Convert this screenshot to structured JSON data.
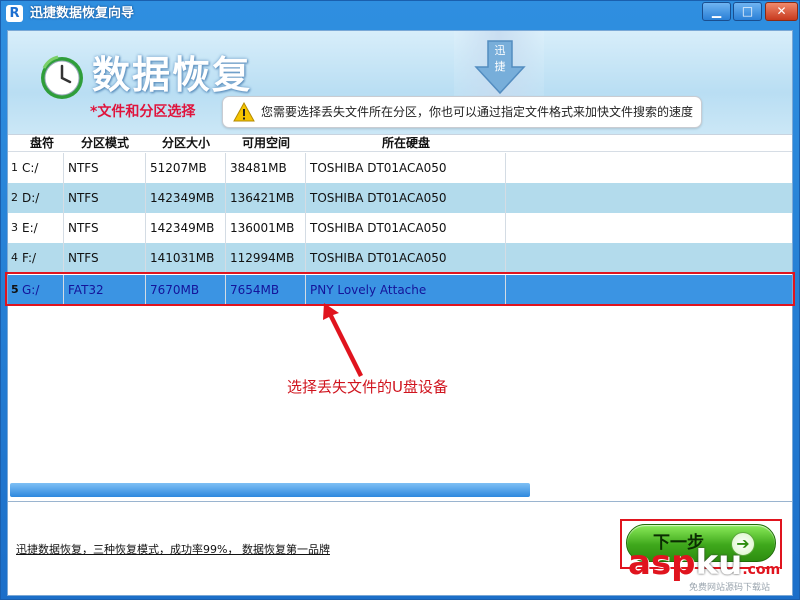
{
  "window": {
    "icon_letter": "R",
    "title": "迅捷数据恢复向导",
    "min_glyph": "▁",
    "max_glyph": "□",
    "close_glyph": "✕"
  },
  "banner": {
    "title": "数据恢复",
    "watermark_text": "迅捷",
    "step_label": "*文件和分区选择",
    "hint": "您需要选择丢失文件所在分区，你也可以通过指定文件格式来加快文件搜索的速度"
  },
  "table": {
    "headers": [
      "盘符",
      "分区模式",
      "分区大小",
      "可用空间",
      "所在硬盘"
    ],
    "rows": [
      {
        "num": "1",
        "drive": "C:/",
        "fs": "NTFS",
        "size": "51207MB",
        "free": "38481MB",
        "disk": "TOSHIBA DT01ACA050"
      },
      {
        "num": "2",
        "drive": "D:/",
        "fs": "NTFS",
        "size": "142349MB",
        "free": "136421MB",
        "disk": "TOSHIBA DT01ACA050"
      },
      {
        "num": "3",
        "drive": "E:/",
        "fs": "NTFS",
        "size": "142349MB",
        "free": "136001MB",
        "disk": "TOSHIBA DT01ACA050"
      },
      {
        "num": "4",
        "drive": "F:/",
        "fs": "NTFS",
        "size": "141031MB",
        "free": "112994MB",
        "disk": "TOSHIBA DT01ACA050"
      },
      {
        "num": "5",
        "drive": "G:/",
        "fs": "FAT32",
        "size": "7670MB",
        "free": "7654MB",
        "disk": "PNY Lovely Attache"
      }
    ],
    "selected_row": 5
  },
  "annotation": {
    "text": "选择丢失文件的U盘设备"
  },
  "footer": {
    "link": "迅捷数据恢复，三种恢复模式，成功率99%， 数据恢复第一品牌",
    "next_label": "下一步",
    "next_icon_glyph": "➔"
  },
  "watermark": {
    "asp": "asp",
    "ku": "ku",
    "com": ".com",
    "sub": "免费网站源码下载站"
  }
}
